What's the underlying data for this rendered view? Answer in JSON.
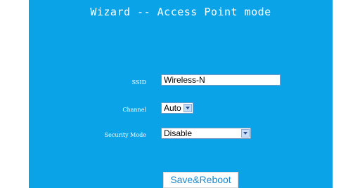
{
  "wizard": {
    "title": "Wizard -- Access Point mode"
  },
  "form": {
    "ssid": {
      "label": "SSID",
      "value": "Wireless-N"
    },
    "channel": {
      "label": "Channel",
      "selected": "Auto"
    },
    "security_mode": {
      "label": "Security Mode",
      "selected": "Disable"
    }
  },
  "actions": {
    "save_reboot_label": "Save&Reboot"
  },
  "colors": {
    "panel_bg": "#0aa3e8",
    "text": "#ffffff",
    "button_text": "#1a88cf"
  }
}
